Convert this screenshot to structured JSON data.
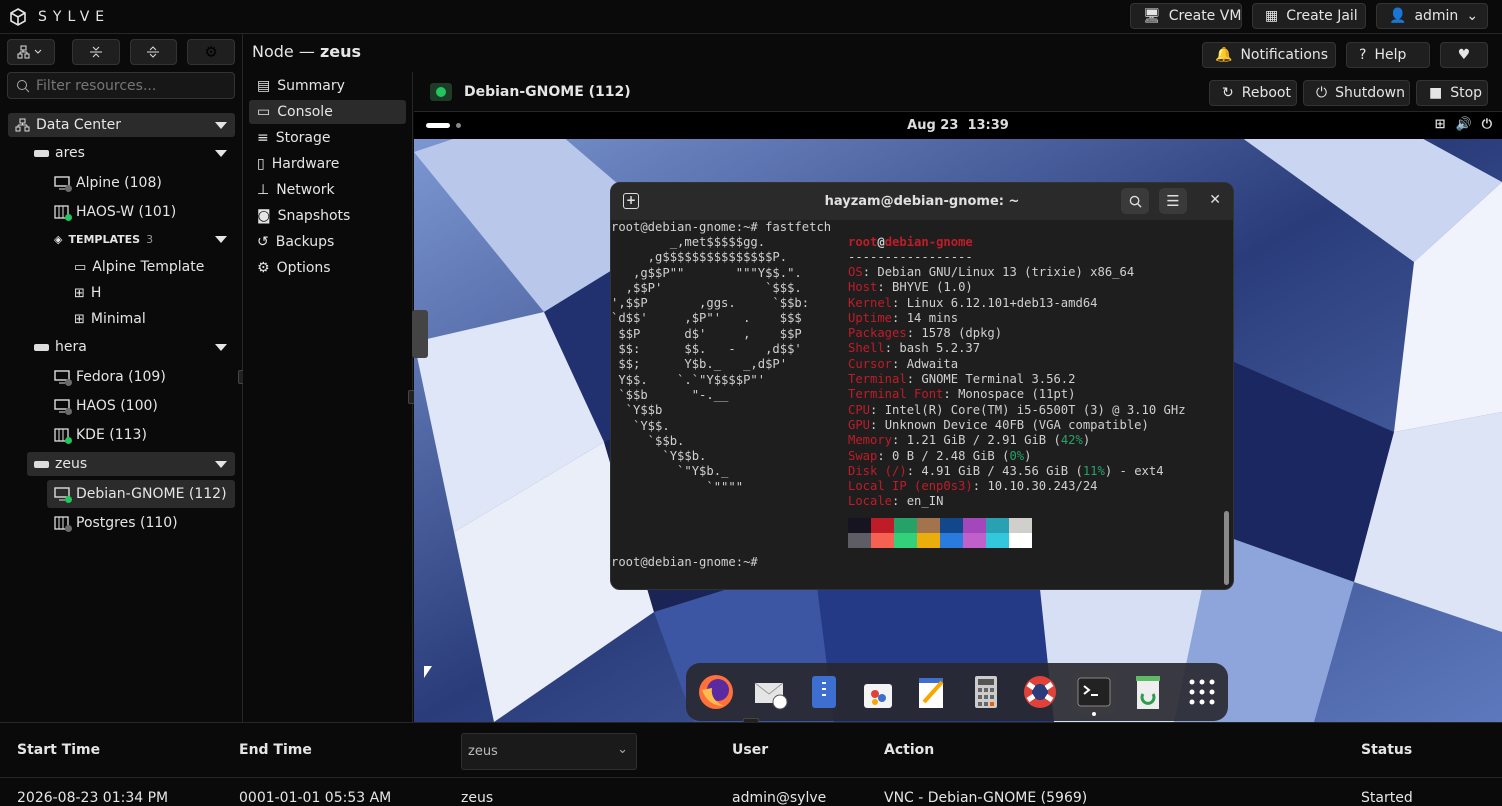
{
  "app": {
    "name": "SYLVE"
  },
  "topbar": {
    "create_vm": "Create VM",
    "create_jail": "Create Jail",
    "user": "admin"
  },
  "header": {
    "node_prefix": "Node —",
    "node_name": "zeus",
    "notifications": "Notifications",
    "help": "Help"
  },
  "sidebar": {
    "filter_placeholder": "Filter resources...",
    "datacenter": "Data Center",
    "nodes": [
      {
        "name": "ares",
        "items": [
          {
            "label": "Alpine (108)",
            "type": "vm",
            "status": "stopped"
          },
          {
            "label": "HAOS-W (101)",
            "type": "jail",
            "status": "running"
          }
        ],
        "templates": {
          "label": "TEMPLATES",
          "count": "3",
          "items": [
            "Alpine Template",
            "H",
            "Minimal"
          ]
        }
      },
      {
        "name": "hera",
        "items": [
          {
            "label": "Fedora (109)",
            "type": "vm",
            "status": "stopped"
          },
          {
            "label": "HAOS (100)",
            "type": "vm",
            "status": "stopped"
          },
          {
            "label": "KDE (113)",
            "type": "jail",
            "status": "running"
          }
        ]
      },
      {
        "name": "zeus",
        "items": [
          {
            "label": "Debian-GNOME (112)",
            "type": "vm",
            "status": "running"
          },
          {
            "label": "Postgres (110)",
            "type": "jail",
            "status": "stopped"
          }
        ]
      }
    ]
  },
  "nav": [
    {
      "label": "Summary",
      "icon": "file-icon"
    },
    {
      "label": "Console",
      "icon": "monitor-icon"
    },
    {
      "label": "Storage",
      "icon": "database-icon"
    },
    {
      "label": "Hardware",
      "icon": "server-icon"
    },
    {
      "label": "Network",
      "icon": "network-icon"
    },
    {
      "label": "Snapshots",
      "icon": "camera-icon"
    },
    {
      "label": "Backups",
      "icon": "history-icon"
    },
    {
      "label": "Options",
      "icon": "gear-icon"
    }
  ],
  "vm": {
    "title": "Debian-GNOME (112)",
    "reboot": "Reboot",
    "shutdown": "Shutdown",
    "stop": "Stop"
  },
  "console": {
    "clock": "Aug 23  13:39",
    "terminal_title": "hayzam@debian-gnome: ~",
    "prompt1": "root@debian-gnome:~# fastfetch",
    "prompt2": "root@debian-gnome:~#",
    "logo": [
      "        _,met$$$$$gg.",
      "     ,g$$$$$$$$$$$$$$$P.",
      "   ,g$$P\"\"       \"\"\"Y$$.\".",
      "  ,$$P'              `$$$.",
      "',$$P       ,ggs.     `$$b:",
      "`d$$'     ,$P\"'   .    $$$",
      " $$P      d$'     ,    $$P",
      " $$:      $$.   -    ,d$$'",
      " $$;      Y$b._   _,d$P'",
      " Y$$.    `.`\"Y$$$$P\"'",
      " `$$b      \"-.__",
      "  `Y$$b",
      "   `Y$$.",
      "     `$$b.",
      "       `Y$$b.",
      "         `\"Y$b._",
      "             `\"\"\"\""
    ],
    "user": "root",
    "at": "@",
    "host": "debian-gnome",
    "sep": "-----------------",
    "info": [
      {
        "k": "OS",
        "v": "Debian GNU/Linux 13 (trixie) x86_64"
      },
      {
        "k": "Host",
        "v": "BHYVE (1.0)"
      },
      {
        "k": "Kernel",
        "v": "Linux 6.12.101+deb13-amd64"
      },
      {
        "k": "Uptime",
        "v": "14 mins"
      },
      {
        "k": "Packages",
        "v": "1578 (dpkg)"
      },
      {
        "k": "Shell",
        "v": "bash 5.2.37"
      },
      {
        "k": "Cursor",
        "v": "Adwaita"
      },
      {
        "k": "Terminal",
        "v": "GNOME Terminal 3.56.2"
      },
      {
        "k": "Terminal Font",
        "v": "Monospace (11pt)"
      },
      {
        "k": "CPU",
        "v": "Intel(R) Core(TM) i5-6500T (3) @ 3.10 GHz"
      },
      {
        "k": "GPU",
        "v": "Unknown Device 40FB (VGA compatible)"
      },
      {
        "k": "Memory",
        "v": "1.21 GiB / 2.91 GiB (",
        "p": "42%",
        "t": ")"
      },
      {
        "k": "Swap",
        "v": "0 B / 2.48 GiB (",
        "p": "0%",
        "t": ")"
      },
      {
        "k": "Disk (/)",
        "v": "4.91 GiB / 43.56 GiB (",
        "p": "11%",
        "t": ") - ext4"
      },
      {
        "k": "Local IP (enp0s3)",
        "v": "10.10.30.243/24"
      },
      {
        "k": "Locale",
        "v": "en_IN"
      }
    ],
    "palette1": [
      "#171421",
      "#c01c28",
      "#26a269",
      "#a2734c",
      "#12488b",
      "#a347ba",
      "#2aa1b3",
      "#d0cfcc"
    ],
    "palette2": [
      "#5e5c64",
      "#f66151",
      "#33d17a",
      "#e9ad0c",
      "#2a7bde",
      "#c061cb",
      "#33c7de",
      "#ffffff"
    ]
  },
  "dock": [
    {
      "name": "firefox-icon"
    },
    {
      "name": "mail-icon"
    },
    {
      "name": "files-icon"
    },
    {
      "name": "software-icon"
    },
    {
      "name": "text-editor-icon"
    },
    {
      "name": "calculator-icon"
    },
    {
      "name": "help-icon"
    },
    {
      "name": "terminal-icon"
    },
    {
      "name": "trash-icon"
    },
    {
      "name": "app-grid-icon"
    }
  ],
  "table": {
    "headers": {
      "start": "Start Time",
      "end": "End Time",
      "node_filter": "zeus",
      "user": "User",
      "action": "Action",
      "status": "Status"
    },
    "rows": [
      {
        "start": "2026-08-23 01:34 PM",
        "end": "0001-01-01 05:53 AM",
        "node": "zeus",
        "user": "admin@sylve",
        "action": "VNC - Debian-GNOME (5969)",
        "status": "Started"
      }
    ]
  },
  "colors": {
    "running": "#22c55e",
    "stopped": "#6b6b6b",
    "term_red": "#c01c28"
  }
}
